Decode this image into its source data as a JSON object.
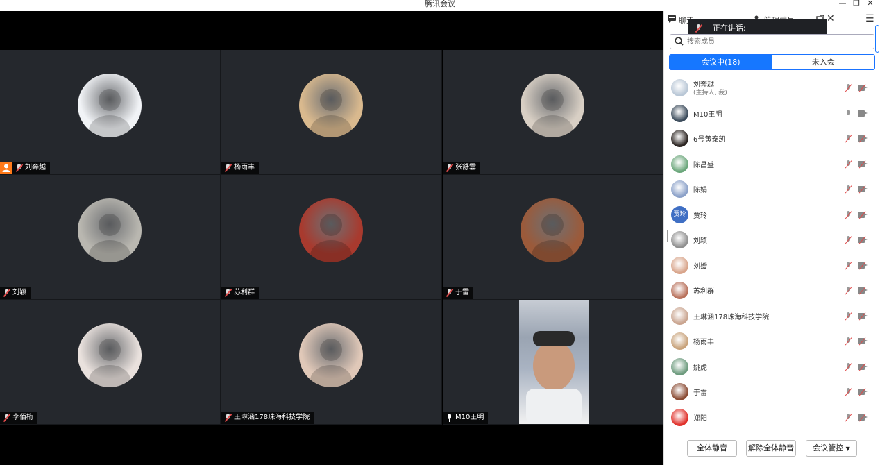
{
  "window": {
    "title": "腾讯会议",
    "min": "—",
    "restore": "❐",
    "close": "✕"
  },
  "tiles": [
    {
      "name": "刘奔越",
      "mic": "muted",
      "host": true,
      "bg": "#f1f3f6"
    },
    {
      "name": "杨雨丰",
      "mic": "muted",
      "host": false,
      "bg": "#d9b98e"
    },
    {
      "name": "张舒雲",
      "mic": "muted",
      "host": false,
      "bg": "#d8cfc4"
    },
    {
      "name": "刘颖",
      "mic": "muted",
      "host": false,
      "bg": "#b9b7b0"
    },
    {
      "name": "苏利群",
      "mic": "muted",
      "host": false,
      "bg": "#a83a2e"
    },
    {
      "name": "于雷",
      "mic": "muted",
      "host": false,
      "bg": "#9b5a3a"
    },
    {
      "name": "李佰桁",
      "mic": "muted",
      "host": false,
      "bg": "#e9e1dd"
    },
    {
      "name": "王琳涵178珠海科技学院",
      "mic": "muted",
      "host": false,
      "bg": "#e0c8b8"
    },
    {
      "name": "M10王明",
      "mic": "on",
      "host": false,
      "bg": "#a9b3c2",
      "video": true
    }
  ],
  "panel": {
    "tab_chat": "聊天",
    "tab_members": "管理成员",
    "speaking_label": "正在讲话:",
    "search_placeholder": "搜索成员",
    "seg_in_meeting": "会议中(18)",
    "seg_not_joined": "未入会",
    "members": [
      {
        "name": "刘奔越",
        "sub": "(主持人, 我)",
        "mic": "muted",
        "cam": "muted",
        "color": "#b9c7d6"
      },
      {
        "name": "M10王明",
        "sub": "",
        "mic": "on",
        "cam": "on",
        "color": "#3a4a5a"
      },
      {
        "name": "6号黄泰凯",
        "sub": "",
        "mic": "muted",
        "cam": "muted",
        "color": "#2a2320"
      },
      {
        "name": "陈昌盛",
        "sub": "",
        "mic": "muted",
        "cam": "muted",
        "color": "#6aa67a"
      },
      {
        "name": "陈娟",
        "sub": "",
        "mic": "muted",
        "cam": "muted",
        "color": "#8aa0c8"
      },
      {
        "name": "贾玲",
        "sub": "",
        "mic": "muted",
        "cam": "muted",
        "color": "#3f6fc4",
        "initials": "贾玲"
      },
      {
        "name": "刘颖",
        "sub": "",
        "mic": "muted",
        "cam": "muted",
        "color": "#8f8f8f"
      },
      {
        "name": "刘嫒",
        "sub": "",
        "mic": "muted",
        "cam": "muted",
        "color": "#d8a48a"
      },
      {
        "name": "苏利群",
        "sub": "",
        "mic": "muted",
        "cam": "muted",
        "color": "#b8705a"
      },
      {
        "name": "王琳涵178珠海科技学院",
        "sub": "",
        "mic": "muted",
        "cam": "muted",
        "color": "#c9a48f"
      },
      {
        "name": "杨雨丰",
        "sub": "",
        "mic": "muted",
        "cam": "muted",
        "color": "#c8a27a"
      },
      {
        "name": "姚虎",
        "sub": "",
        "mic": "muted",
        "cam": "muted",
        "color": "#6d9b7e"
      },
      {
        "name": "于雷",
        "sub": "",
        "mic": "muted",
        "cam": "muted",
        "color": "#8a4b33"
      },
      {
        "name": "郑阳",
        "sub": "",
        "mic": "muted",
        "cam": "muted",
        "color": "#e0302a"
      }
    ],
    "btn_mute_all": "全体静音",
    "btn_unmute_all": "解除全体静音",
    "btn_control": "会议管控"
  },
  "colors": {
    "accent": "#1677ff",
    "host_badge": "#ff7a1a",
    "tile_bg": "#25282d"
  }
}
